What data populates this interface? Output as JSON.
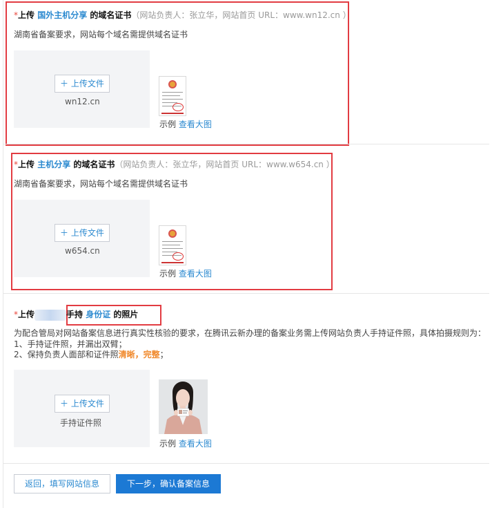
{
  "section1": {
    "star": "*",
    "prefix": "上传 ",
    "site_name": "国外主机分享",
    "suffix": " 的域名证书",
    "note": "（网站负责人：张立华，网站首页 URL：www.wn12.cn ）",
    "description": "湖南省备案要求，网站每个域名需提供域名证书",
    "upload_label": "＋ 上传文件",
    "domain": "wn12.cn",
    "sample_label": "示例",
    "view_large": "查看大图"
  },
  "section2": {
    "star": "*",
    "prefix": "上传 ",
    "site_name": "主机分享",
    "suffix": " 的域名证书",
    "note": "（网站负责人：张立华，网站首页 URL：www.w654.cn ）",
    "description": "湖南省备案要求，网站每个域名需提供域名证书",
    "upload_label": "＋ 上传文件",
    "domain": "w654.cn",
    "sample_label": "示例",
    "view_large": "查看大图"
  },
  "section3": {
    "star": "*",
    "prefix": "上传",
    "hand_label": "手持 ",
    "id_label": "身份证",
    "suffix": " 的照片",
    "description": "为配合管局对网站备案信息进行真实性核验的要求，在腾讯云新办理的备案业务需上传网站负责人手持证件照，具体拍摄规则为：",
    "rule1": "1、手持证件照，并漏出双臂；",
    "rule2_prefix": "2、保持负责人面部和证件照",
    "rule2_emph": "清晰，完整",
    "rule2_suffix": "；",
    "upload_label": "＋ 上传文件",
    "upload_caption": "手持证件照",
    "sample_label": "示例",
    "view_large": "查看大图"
  },
  "footer": {
    "back_label": "返回，填写网站信息",
    "next_label": "下一步，确认备案信息"
  },
  "colors": {
    "accent": "#2c8ad0",
    "primary_button": "#1c79d4",
    "highlight_box": "#e23b41",
    "required_star": "#e9473c",
    "emphasis": "#f0892c"
  }
}
